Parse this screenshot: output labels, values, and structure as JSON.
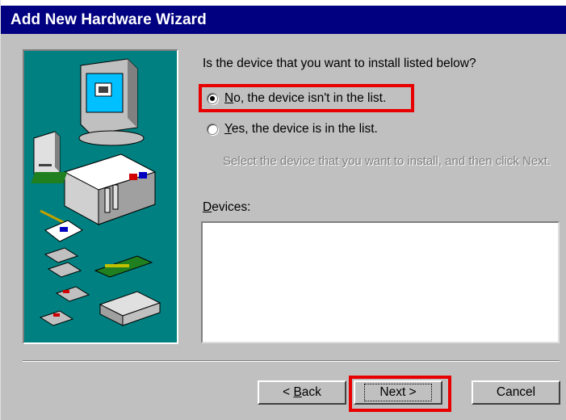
{
  "window": {
    "title": "Add New Hardware Wizard"
  },
  "illustration": {
    "icon": "hardware-devices-illustration"
  },
  "question": "Is the device that you want to install listed below?",
  "options": {
    "no": {
      "mnemonic": "N",
      "rest": "o, the device isn't in the list.",
      "selected": true
    },
    "yes": {
      "mnemonic": "Y",
      "rest": "es, the device is in the list.",
      "selected": false
    }
  },
  "hint": "Select the device that you want to install, and then click Next.",
  "devices": {
    "label_mnemonic": "D",
    "label_rest": "evices:",
    "items": []
  },
  "buttons": {
    "back": {
      "prefix": "< ",
      "mnemonic": "B",
      "rest": "ack"
    },
    "next": "Next >",
    "cancel": "Cancel"
  },
  "colors": {
    "title_bar": "#000080",
    "dialog_bg": "#c0c0c0",
    "illustration_bg": "#008080",
    "highlight": "#e80000"
  }
}
